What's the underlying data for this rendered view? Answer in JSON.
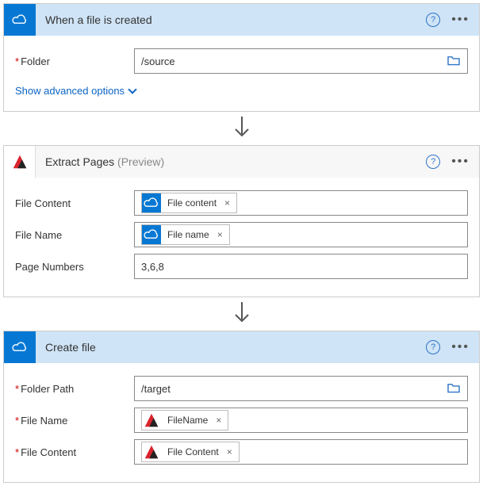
{
  "step1": {
    "title": "When a file is created",
    "fields": {
      "folder": {
        "label": "Folder",
        "value": "/source",
        "required": true
      }
    },
    "advanced": "Show advanced options"
  },
  "step2": {
    "title": "Extract Pages",
    "suffix": "(Preview)",
    "fields": {
      "file_content": {
        "label": "File Content",
        "token": "File content"
      },
      "file_name": {
        "label": "File Name",
        "token": "File name"
      },
      "page_numbers": {
        "label": "Page Numbers",
        "value": "3,6,8"
      }
    }
  },
  "step3": {
    "title": "Create file",
    "fields": {
      "folder_path": {
        "label": "Folder Path",
        "value": "/target",
        "required": true
      },
      "file_name": {
        "label": "File Name",
        "token": "FileName",
        "required": true
      },
      "file_content": {
        "label": "File Content",
        "token": "File Content",
        "required": true
      }
    }
  }
}
